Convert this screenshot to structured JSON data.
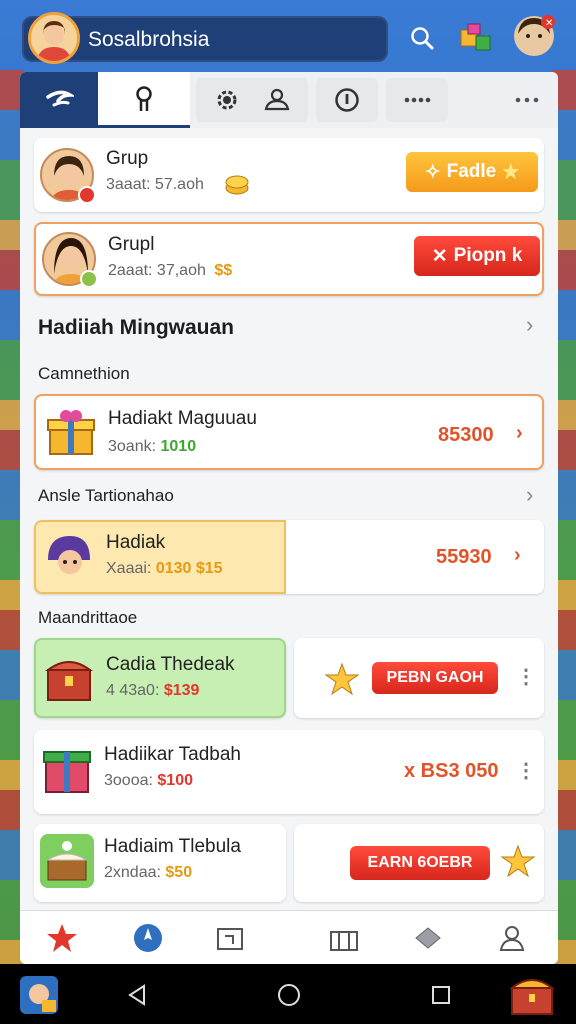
{
  "app": {
    "title": "Sosalbrohsia"
  },
  "cards_top": [
    {
      "name": "Grup",
      "stats": "3aaat: 57.aoh",
      "button": "Fadle"
    },
    {
      "name": "Grupl",
      "stats": "2aaat: 37,aoh",
      "coin": "$$",
      "button": "Piopn k"
    }
  ],
  "section_main": {
    "title": "Hadiiah Mingwauan"
  },
  "groups": [
    {
      "label": "Camnethion",
      "rows": [
        {
          "title": "Hadiakt Maguuau",
          "sub_prefix": "3oank:",
          "sub_value": "1010",
          "value": "85300"
        }
      ]
    },
    {
      "label": "Ansle Tartionahao",
      "rows": [
        {
          "title": "Hadiak",
          "sub_prefix": "Xaaai:",
          "sub_value": "0130",
          "sub_value2": "$15",
          "value": "55930"
        }
      ]
    },
    {
      "label": "Maandrittaoe",
      "rows": [
        {
          "title": "Cadia Thedeak",
          "sub_prefix": "4 43a0:",
          "sub_value": "$139",
          "button": "PEBN GAOH"
        },
        {
          "title": "Hadiikar Tadbah",
          "sub_prefix": "3oooa:",
          "sub_value": "$100",
          "value": "x BS3 050"
        },
        {
          "title": "Hadiaim Tlebula",
          "sub_prefix": "2xndaa:",
          "sub_value": "$50",
          "button": "EARN 6OEBR"
        }
      ]
    }
  ],
  "colors": {
    "brand": "#1f3f78",
    "accent_red": "#e2372b",
    "accent_yellow": "#f5a623",
    "highlight_yellow": "#fde8b0",
    "highlight_green": "#c7efb4"
  },
  "icons": {
    "top": [
      "search-icon",
      "gift-boxes-icon",
      "profile-avatar-icon"
    ],
    "tabs": [
      "logo-icon",
      "location-icon",
      "gear-icon",
      "people-icon",
      "info-icon",
      "more-icon",
      "overflow-icon"
    ],
    "bottom_nav": [
      "star-icon",
      "compass-icon",
      "folder-icon",
      "gifts-icon",
      "tag-icon",
      "user-icon"
    ]
  }
}
